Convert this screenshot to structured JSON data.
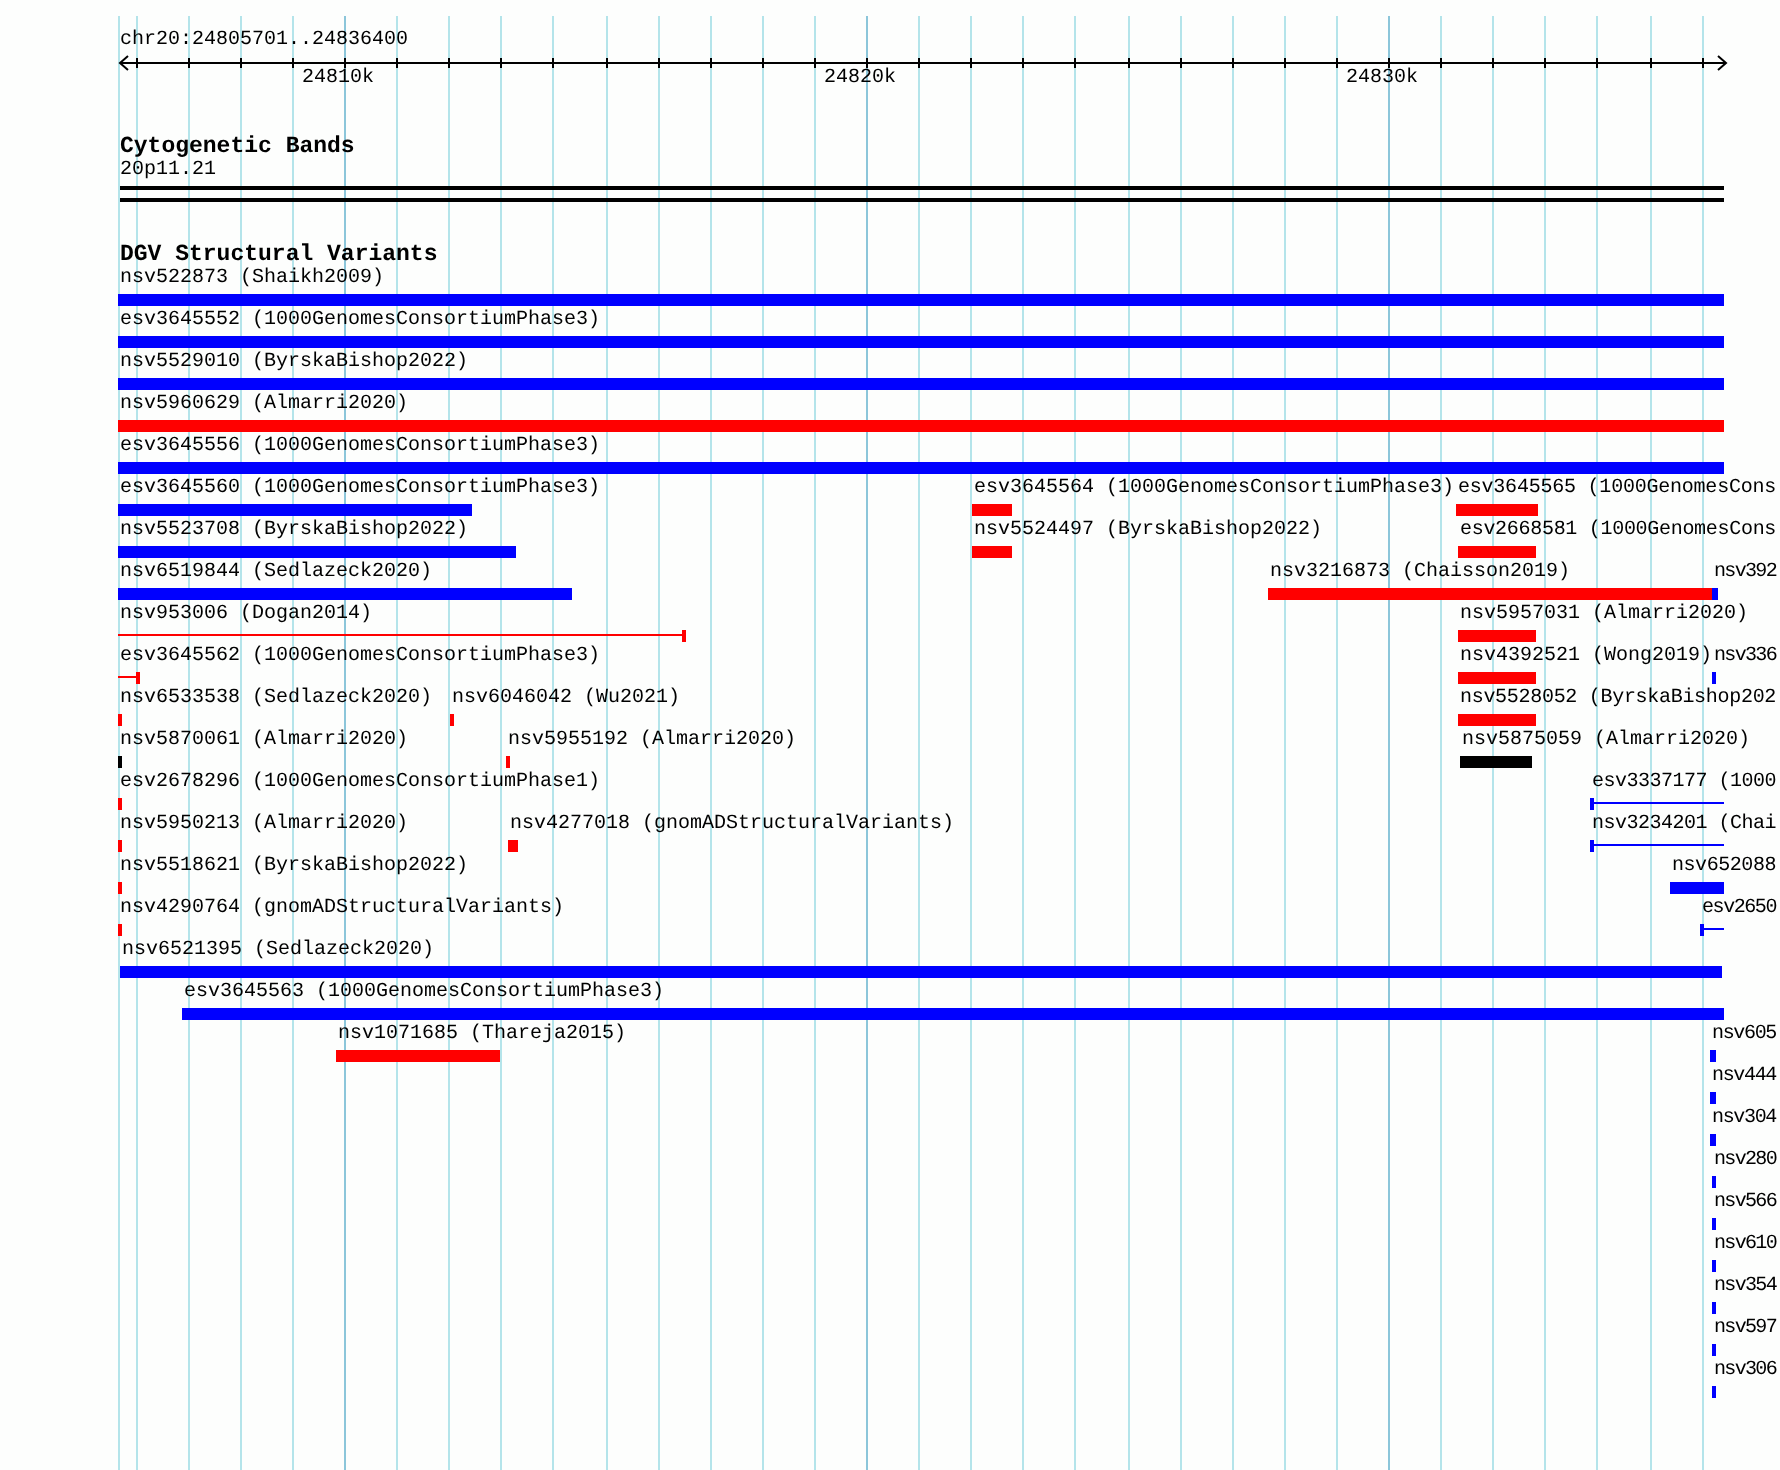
{
  "ruler": {
    "position": "chr20:24805701..24836400",
    "tick_labels": [
      "24810k",
      "24820k",
      "24830k"
    ]
  },
  "cytogenetic_track": {
    "title": "Cytogenetic Bands",
    "band": "20p11.21"
  },
  "dgv_track": {
    "title": "DGV Structural Variants",
    "features": [
      {
        "label": "nsv522873 (Shaikh2009)",
        "kind": "bar",
        "color": "#0000ff"
      },
      {
        "label": "esv3645552 (1000GenomesConsortiumPhase3)",
        "kind": "bar",
        "color": "#0000ff"
      },
      {
        "label": "nsv5529010 (ByrskaBishop2022)",
        "kind": "bar",
        "color": "#0000ff"
      },
      {
        "label": "nsv5960629 (Almarri2020)",
        "kind": "bar",
        "color": "#ff0000"
      },
      {
        "label": "esv3645556 (1000GenomesConsortiumPhase3)",
        "kind": "bar",
        "color": "#0000ff"
      },
      {
        "label": "esv3645560 (1000GenomesConsortiumPhase3)",
        "kind": "bar",
        "color": "#0000ff"
      },
      {
        "label": "esv3645564 (1000GenomesConsortiumPhase3)",
        "kind": "bar",
        "color": "#ff0000"
      },
      {
        "label": "esv3645565 (1000GenomesCons",
        "kind": "bar",
        "color": "#ff0000"
      },
      {
        "label": "nsv5523708 (ByrskaBishop2022)",
        "kind": "bar",
        "color": "#0000ff"
      },
      {
        "label": "nsv5524497 (ByrskaBishop2022)",
        "kind": "bar",
        "color": "#ff0000"
      },
      {
        "label": "esv2668581 (1000GenomesCons",
        "kind": "bar",
        "color": "#ff0000"
      },
      {
        "label": "nsv6519844 (Sedlazeck2020)",
        "kind": "bar",
        "color": "#0000ff"
      },
      {
        "label": "nsv3216873 (Chaisson2019)",
        "kind": "bar",
        "color": "#ff0000"
      },
      {
        "label": "nsv392",
        "kind": "tick",
        "color": "#0000ff"
      },
      {
        "label": "nsv953006 (Dogan2014)",
        "kind": "span",
        "color": "#ff0000"
      },
      {
        "label": "nsv5957031 (Almarri2020)",
        "kind": "bar",
        "color": "#ff0000"
      },
      {
        "label": "esv3645562 (1000GenomesConsortiumPhase3)",
        "kind": "span",
        "color": "#ff0000"
      },
      {
        "label": "nsv4392521 (Wong2019)",
        "kind": "bar",
        "color": "#ff0000"
      },
      {
        "label": "nsv336",
        "kind": "tick",
        "color": "#0000ff"
      },
      {
        "label": "nsv6533538 (Sedlazeck2020)",
        "kind": "tick",
        "color": "#ff0000"
      },
      {
        "label": "nsv6046042 (Wu2021)",
        "kind": "tick",
        "color": "#ff0000"
      },
      {
        "label": "nsv5528052 (ByrskaBishop202",
        "kind": "bar",
        "color": "#ff0000"
      },
      {
        "label": "nsv5870061 (Almarri2020)",
        "kind": "tick",
        "color": "#000000"
      },
      {
        "label": "nsv5955192 (Almarri2020)",
        "kind": "tick",
        "color": "#ff0000"
      },
      {
        "label": "nsv5875059 (Almarri2020)",
        "kind": "bar",
        "color": "#000000"
      },
      {
        "label": "esv2678296 (1000GenomesConsortiumPhase1)",
        "kind": "tick",
        "color": "#ff0000"
      },
      {
        "label": "esv3337177 (1000",
        "kind": "span",
        "color": "#0000ff"
      },
      {
        "label": "nsv5950213 (Almarri2020)",
        "kind": "tick",
        "color": "#ff0000"
      },
      {
        "label": "nsv4277018 (gnomADStructuralVariants)",
        "kind": "bar",
        "color": "#ff0000"
      },
      {
        "label": "nsv3234201 (Chai",
        "kind": "span",
        "color": "#0000ff"
      },
      {
        "label": "nsv5518621 (ByrskaBishop2022)",
        "kind": "tick",
        "color": "#ff0000"
      },
      {
        "label": "nsv652088",
        "kind": "bar",
        "color": "#0000ff"
      },
      {
        "label": "nsv4290764 (gnomADStructuralVariants)",
        "kind": "tick",
        "color": "#ff0000"
      },
      {
        "label": "esv2650",
        "kind": "span",
        "color": "#0000ff"
      },
      {
        "label": "nsv6521395 (Sedlazeck2020)",
        "kind": "bar",
        "color": "#0000ff"
      },
      {
        "label": "esv3645563 (1000GenomesConsortiumPhase3)",
        "kind": "bar",
        "color": "#0000ff"
      },
      {
        "label": "nsv1071685 (Thareja2015)",
        "kind": "bar",
        "color": "#ff0000"
      },
      {
        "label": "nsv605",
        "kind": "tick",
        "color": "#0000ff"
      },
      {
        "label": "nsv444",
        "kind": "tick",
        "color": "#0000ff"
      },
      {
        "label": "nsv304",
        "kind": "tick",
        "color": "#0000ff"
      },
      {
        "label": "nsv280",
        "kind": "tick",
        "color": "#0000ff"
      },
      {
        "label": "nsv566",
        "kind": "tick",
        "color": "#0000ff"
      },
      {
        "label": "nsv610",
        "kind": "tick",
        "color": "#0000ff"
      },
      {
        "label": "nsv354",
        "kind": "tick",
        "color": "#0000ff"
      },
      {
        "label": "nsv597",
        "kind": "tick",
        "color": "#0000ff"
      },
      {
        "label": "nsv306",
        "kind": "tick",
        "color": "#0000ff"
      }
    ]
  }
}
